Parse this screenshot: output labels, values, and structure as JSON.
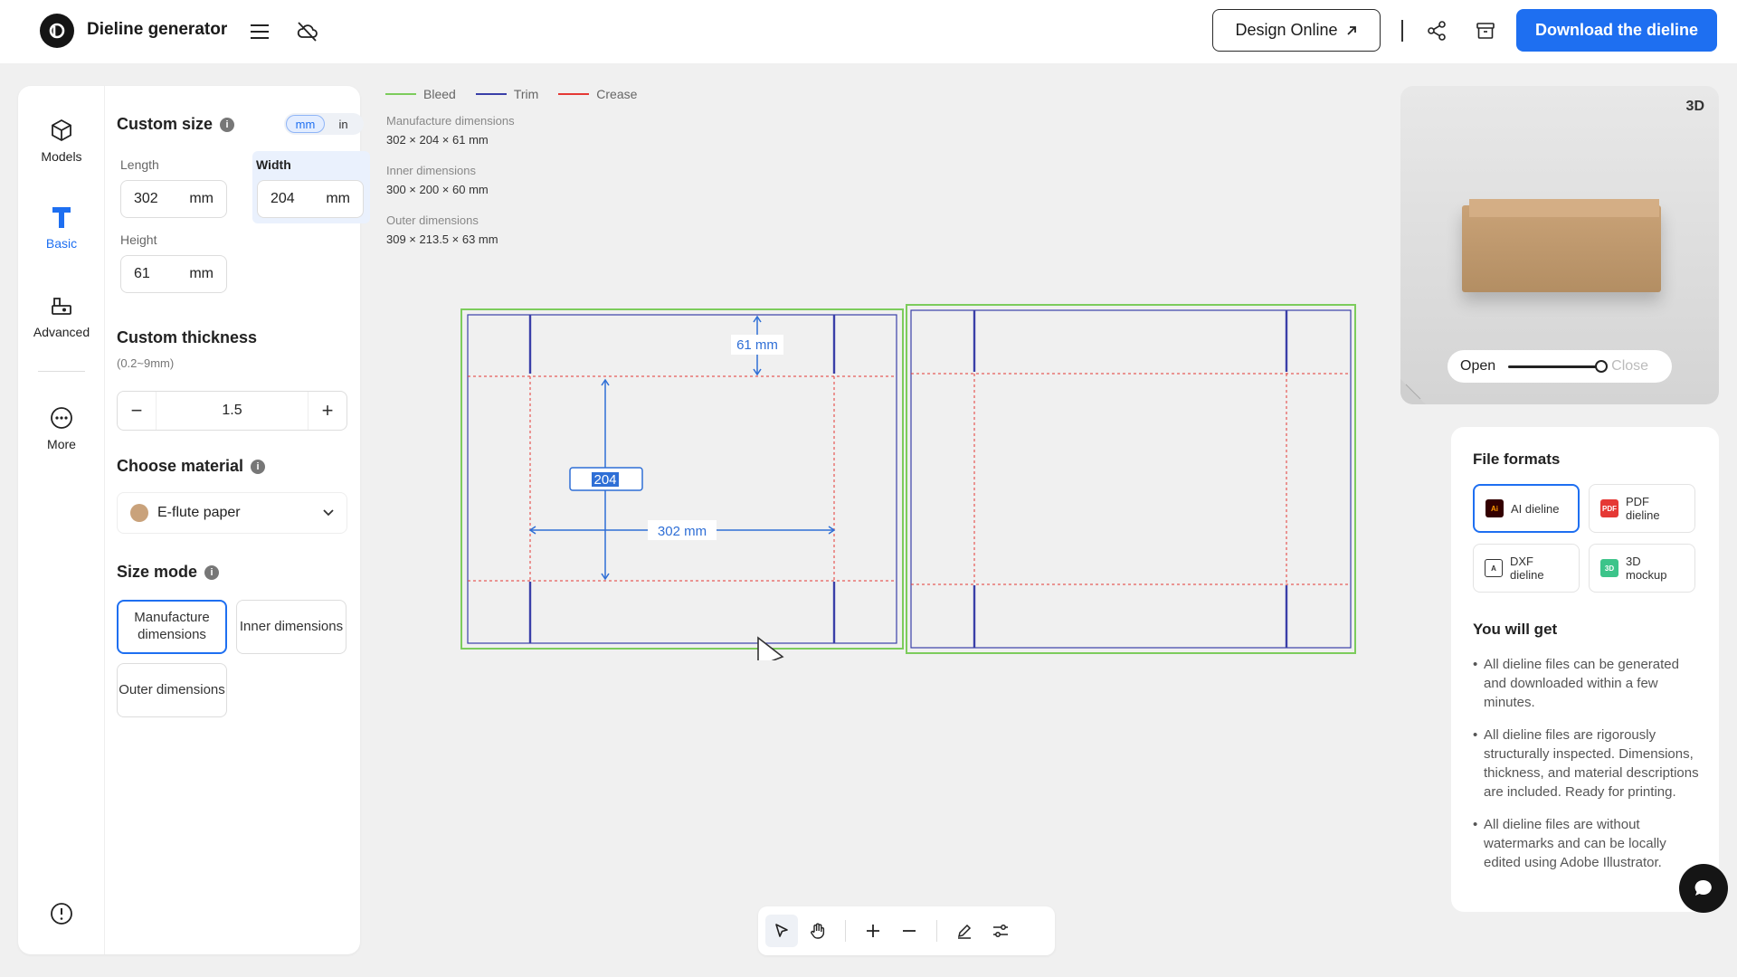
{
  "header": {
    "app_title": "Dieline generator",
    "design_online_label": "Design Online",
    "download_label": "Download the dieline",
    "brand_color": "#1e6ff1",
    "icons": [
      "logo-icon",
      "menu-icon",
      "cloud-off-icon",
      "external-arrow-icon",
      "share-icon",
      "box-icon"
    ]
  },
  "rail": {
    "items": [
      {
        "label": "Models",
        "icon": "cube-icon"
      },
      {
        "label": "Basic",
        "icon": "text-tool-icon",
        "active": true
      },
      {
        "label": "Advanced",
        "icon": "advanced-icon"
      },
      {
        "label": "More",
        "icon": "more-icon"
      }
    ],
    "bottom_icon": "info-icon"
  },
  "settings": {
    "custom_size_title": "Custom size",
    "units": [
      "mm",
      "in"
    ],
    "selected_unit": "mm",
    "length_label": "Length",
    "length_value": "302",
    "width_label": "Width",
    "width_value": "204",
    "height_label": "Height",
    "height_value": "61",
    "unit_suffix": "mm",
    "thickness_title": "Custom thickness",
    "thickness_hint": "(0.2~9mm)",
    "thickness_value": "1.5",
    "minus_label": "−",
    "plus_label": "+",
    "material_title": "Choose material",
    "material_value": "E-flute paper",
    "material_color": "#c9a27b",
    "size_mode_title": "Size mode",
    "size_modes": [
      "Manufacture dimensions",
      "Inner dimensions",
      "Outer dimensions"
    ],
    "selected_size_mode": "Manufacture dimensions"
  },
  "canvas": {
    "legend": [
      {
        "label": "Bleed",
        "color": "#7ccc5c"
      },
      {
        "label": "Trim",
        "color": "#3a3fa8"
      },
      {
        "label": "Crease",
        "color": "#e53935"
      }
    ],
    "dimensions": [
      {
        "label": "Manufacture dimensions",
        "value": "302 × 204 × 61 mm"
      },
      {
        "label": "Inner dimensions",
        "value": "300 × 200 × 60 mm"
      },
      {
        "label": "Outer dimensions",
        "value": "309 × 213.5 × 63 mm"
      }
    ],
    "annotations": {
      "height_dim": "61 mm",
      "width_edit": "204",
      "length_dim": "302 mm"
    },
    "annotation_color": "#2f6fd6"
  },
  "toolbar": {
    "tools": [
      "select-pointer-icon",
      "hand-pan-icon",
      "zoom-in-icon",
      "zoom-out-icon",
      "pen-icon",
      "sliders-icon"
    ],
    "active_tool": "select-pointer-icon"
  },
  "preview": {
    "badge": "3D",
    "open_label": "Open",
    "close_label": "Close",
    "fold_level": 1.0
  },
  "formats": {
    "title": "File formats",
    "items": [
      {
        "label": "AI dieline",
        "icon": "ai-file-icon",
        "selected": true
      },
      {
        "label": "PDF dieline",
        "icon": "pdf-file-icon"
      },
      {
        "label": "DXF dieline",
        "icon": "dxf-file-icon"
      },
      {
        "label": "3D mockup",
        "icon": "mockup-icon"
      }
    ],
    "you_will_get_title": "You will get",
    "benefits": [
      "All dieline files can be generated and downloaded within a few minutes.",
      "All dieline files are rigorously structurally inspected. Dimensions, thickness, and material descriptions are included. Ready for printing.",
      "All dieline files are without watermarks and can be locally edited using Adobe Illustrator."
    ]
  }
}
